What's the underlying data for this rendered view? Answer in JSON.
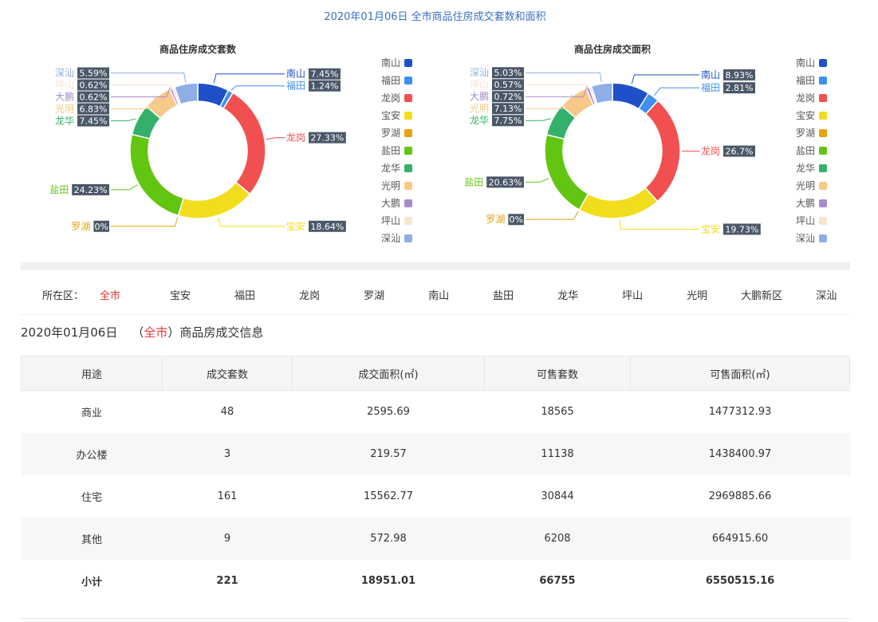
{
  "page": {
    "title": "2020年01月06日 全市商品住房成交套数和面积"
  },
  "chart_data": [
    {
      "type": "pie",
      "variant": "donut",
      "title": "商品住房成交套数",
      "categories": [
        "南山",
        "福田",
        "龙岗",
        "宝安",
        "罗湖",
        "盐田",
        "龙华",
        "光明",
        "大鹏",
        "坪山",
        "深汕"
      ],
      "values": [
        7.45,
        1.24,
        27.33,
        18.64,
        0,
        24.23,
        7.45,
        6.83,
        0.62,
        0.62,
        5.59
      ],
      "labels": [
        "7.45%",
        "1.24%",
        "27.33%",
        "18.64%",
        "0%",
        "24.23%",
        "7.45%",
        "6.83%",
        "0.62%",
        "0.62%",
        "5.59%"
      ],
      "unit": "%",
      "legend_position": "right"
    },
    {
      "type": "pie",
      "variant": "donut",
      "title": "商品住房成交面积",
      "categories": [
        "南山",
        "福田",
        "龙岗",
        "宝安",
        "罗湖",
        "盐田",
        "龙华",
        "光明",
        "大鹏",
        "坪山",
        "深汕"
      ],
      "values": [
        8.93,
        2.81,
        26.7,
        19.73,
        0,
        20.63,
        7.75,
        7.13,
        0.72,
        0.57,
        5.03
      ],
      "labels": [
        "8.93%",
        "2.81%",
        "26.7%",
        "19.73%",
        "0%",
        "20.63%",
        "7.75%",
        "7.13%",
        "0.72%",
        "0.57%",
        "5.03%"
      ],
      "unit": "%",
      "legend_position": "right"
    }
  ],
  "colors": [
    "#1f4fc9",
    "#3d8ff0",
    "#f25050",
    "#f2dd1d",
    "#e8a20c",
    "#62c512",
    "#35b06a",
    "#f7c98a",
    "#a98ac9",
    "#f7e3cf",
    "#8eaee6"
  ],
  "district_filter": {
    "label": "所在区：",
    "items": [
      "全市",
      "宝安",
      "福田",
      "龙岗",
      "罗湖",
      "南山",
      "盐田",
      "龙华",
      "坪山",
      "光明",
      "大鹏新区",
      "深汕"
    ],
    "active": "全市"
  },
  "info": {
    "date": "2020年01月06日",
    "open_paren": "（",
    "scope": "全市",
    "close_text": "）商品房成交信息"
  },
  "table": {
    "headers": [
      "用途",
      "成交套数",
      "成交面积(㎡)",
      "可售套数",
      "可售面积(㎡)"
    ],
    "rows": [
      [
        "商业",
        "48",
        "2595.69",
        "18565",
        "1477312.93"
      ],
      [
        "办公楼",
        "3",
        "219.57",
        "11138",
        "1438400.97"
      ],
      [
        "住宅",
        "161",
        "15562.77",
        "30844",
        "2969885.66"
      ],
      [
        "其他",
        "9",
        "572.98",
        "6208",
        "664915.60"
      ]
    ],
    "total": [
      "小计",
      "221",
      "18951.01",
      "66755",
      "6550515.16"
    ]
  }
}
